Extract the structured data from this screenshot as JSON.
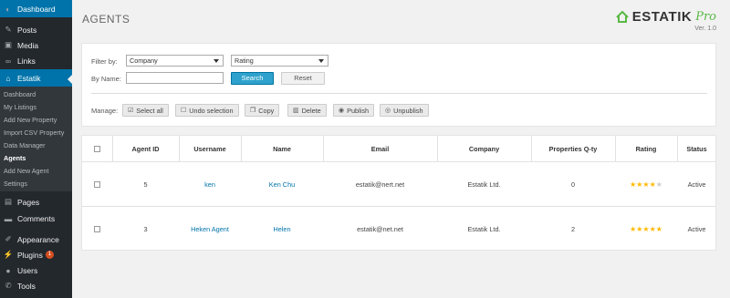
{
  "sidebar": {
    "items": [
      {
        "label": "Dashboard",
        "icon": "dashboard-icon",
        "glyph": "◐"
      },
      {
        "label": "Posts",
        "icon": "pin-icon",
        "glyph": "✎"
      },
      {
        "label": "Media",
        "icon": "media-icon",
        "glyph": "▣"
      },
      {
        "label": "Links",
        "icon": "link-icon",
        "glyph": "∞"
      },
      {
        "label": "Estatik",
        "icon": "home-icon",
        "glyph": "⌂"
      },
      {
        "label": "Pages",
        "icon": "pages-icon",
        "glyph": "▤"
      },
      {
        "label": "Comments",
        "icon": "comment-icon",
        "glyph": "▬"
      },
      {
        "label": "Appearance",
        "icon": "brush-icon",
        "glyph": "✐"
      },
      {
        "label": "Plugins",
        "icon": "plugin-icon",
        "glyph": "⚡",
        "badge": "1"
      },
      {
        "label": "Users",
        "icon": "user-icon",
        "glyph": "●"
      },
      {
        "label": "Tools",
        "icon": "wrench-icon",
        "glyph": "✆"
      }
    ],
    "submenu": [
      "Dashboard",
      "My Listings",
      "Add New Property",
      "Import CSV Property",
      "Data Manager",
      "Agents",
      "Add New Agent",
      "Settings"
    ]
  },
  "header": {
    "title": "AGENTS",
    "brand_name": "ESTATIK",
    "brand_pro": "Pro",
    "version": "Ver. 1.0"
  },
  "filter": {
    "filter_by_label": "Filter by:",
    "company_select": "Company",
    "rating_select": "Rating",
    "by_name_label": "By Name:",
    "name_value": "",
    "search_label": "Search",
    "reset_label": "Reset"
  },
  "manage": {
    "label": "Manage:",
    "buttons": [
      {
        "label": "Select all",
        "icon": "checkbox-icon",
        "glyph": "☑"
      },
      {
        "label": "Undo selection",
        "icon": "square-icon",
        "glyph": "☐"
      },
      {
        "label": "Copy",
        "icon": "copy-icon",
        "glyph": "❐"
      },
      {
        "label": "Delete",
        "icon": "trash-icon",
        "glyph": "▥"
      },
      {
        "label": "Publish",
        "icon": "eye-icon",
        "glyph": "◉"
      },
      {
        "label": "Unpublish",
        "icon": "eye-off-icon",
        "glyph": "◎"
      }
    ]
  },
  "table": {
    "columns": [
      "",
      "Agent ID",
      "Username",
      "Name",
      "Email",
      "Company",
      "Properties Q-ty",
      "Rating",
      "Status"
    ],
    "rows": [
      {
        "id": "5",
        "username": "ken",
        "name": "Ken Chu",
        "email": "estatik@nert.net",
        "company": "Estatik Ltd.",
        "properties": "0",
        "rating": 4,
        "status": "Active"
      },
      {
        "id": "3",
        "username": "Heken Agent",
        "name": "Helen",
        "email": "estatik@net.net",
        "company": "Estatik Ltd.",
        "properties": "2",
        "rating": 5,
        "status": "Active"
      }
    ]
  },
  "colors": {
    "sidebar_bg": "#23282d",
    "active_blue": "#0073aa",
    "search_button": "#2ea2cc",
    "star_gold": "#ffb900",
    "brand_green": "#5ab946"
  }
}
